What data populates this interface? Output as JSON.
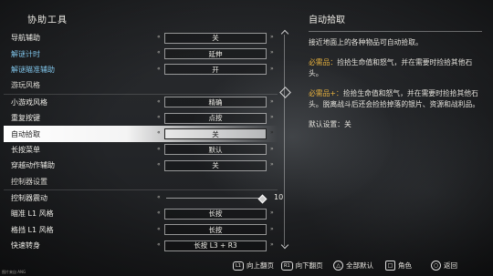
{
  "panel_title": "协助工具",
  "rows": [
    {
      "label": "导航辅助",
      "value": "关",
      "style": "normal"
    },
    {
      "label": "解谜计时",
      "value": "延伸",
      "style": "blue"
    },
    {
      "label": "解谜瞄准辅助",
      "value": "开",
      "style": "blue"
    },
    {
      "label": "游玩风格",
      "value": "",
      "style": "header"
    },
    {
      "label": "小游戏风格",
      "value": "精确",
      "style": "normal"
    },
    {
      "label": "重复按键",
      "value": "点按",
      "style": "normal"
    },
    {
      "label": "自动拾取",
      "value": "关",
      "style": "selected"
    },
    {
      "label": "长按菜单",
      "value": "默认",
      "style": "normal"
    },
    {
      "label": "穿越动作辅助",
      "value": "关",
      "style": "normal"
    },
    {
      "label": "控制器设置",
      "value": "",
      "style": "header"
    },
    {
      "label": "控制器震动",
      "value": "10",
      "style": "slider",
      "level": 10
    },
    {
      "label": "瞄准 L1 风格",
      "value": "长按",
      "style": "normal"
    },
    {
      "label": "格挡 L1 风格",
      "value": "长按",
      "style": "normal"
    },
    {
      "label": "快速转身",
      "value": "长按 L3 + R3",
      "style": "normal"
    }
  ],
  "detail": {
    "title": "自动拾取",
    "description": "接近地面上的各种物品可自动拾取。",
    "tier1_label": "必需品：",
    "tier1_text": "捡拾生命值和怒气，并在需要时捡拾其他石头。",
    "tier2_label": "必需品+：",
    "tier2_text": "捡拾生命值和怒气，并在需要时捡拾其他石头。脱离战斗后还会捡拾掉落的银片、资源和战利品。",
    "default_label": "默认设置：",
    "default_value": "关"
  },
  "hints": {
    "prev_page": "向上翻页",
    "prev_btn": "L1",
    "next_page": "向下翻页",
    "next_btn": "R1",
    "default_all": "全部默认",
    "character": "角色",
    "back": "返回"
  },
  "watermark": "图片来自 ANG"
}
